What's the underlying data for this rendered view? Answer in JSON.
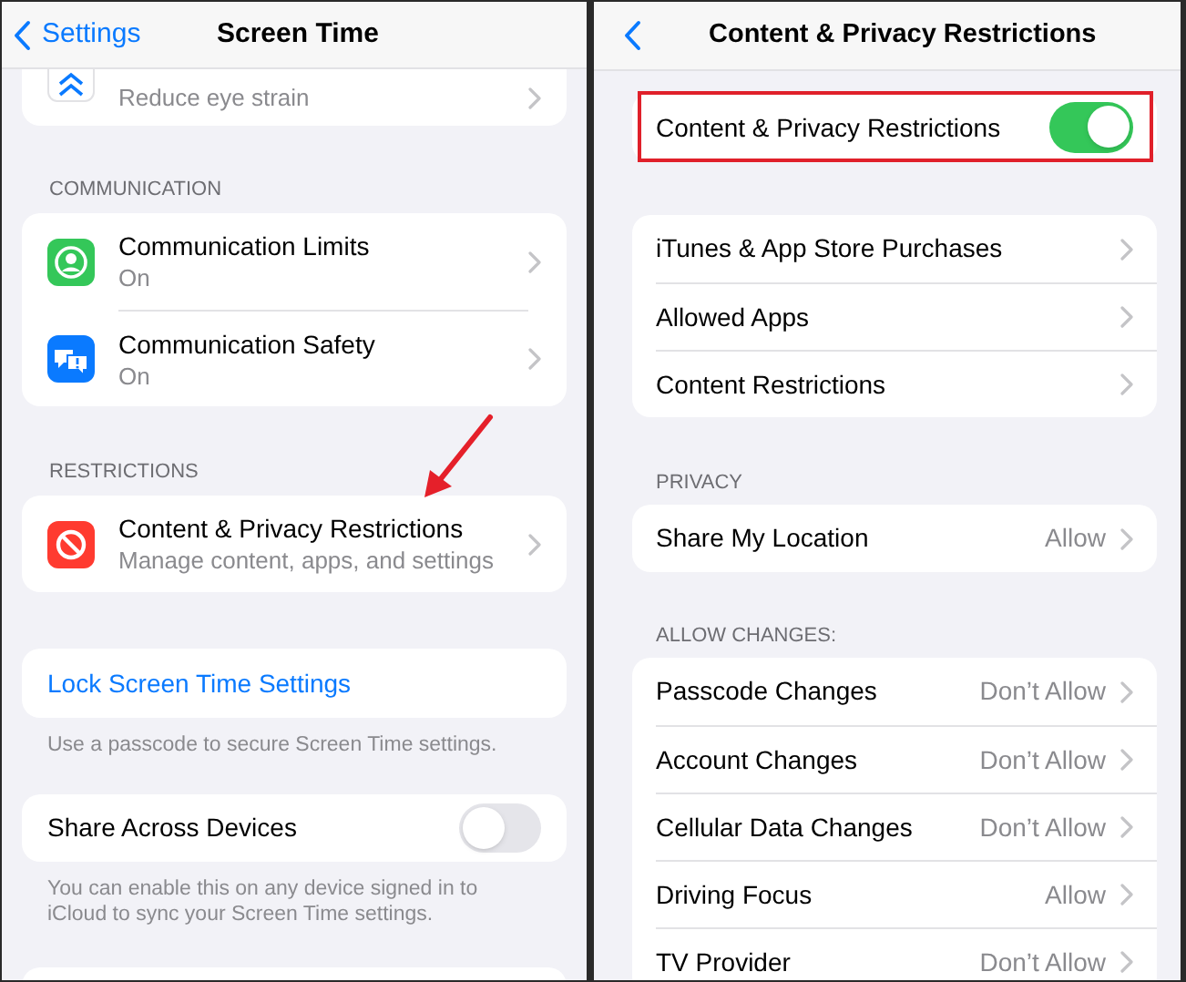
{
  "left": {
    "nav": {
      "back": "Settings",
      "title": "Screen Time"
    },
    "partial_item": {
      "subtitle": "Reduce eye strain"
    },
    "sections": [
      {
        "header": "COMMUNICATION",
        "rows": [
          {
            "title": "Communication Limits",
            "subtitle": "On",
            "color": "#34c759"
          },
          {
            "title": "Communication Safety",
            "subtitle": "On",
            "color": "#0a7aff"
          }
        ]
      },
      {
        "header": "RESTRICTIONS",
        "rows": [
          {
            "title": "Content & Privacy Restrictions",
            "subtitle": "Manage content, apps, and settings",
            "color": "#ff3b30"
          }
        ]
      }
    ],
    "lock": {
      "label": "Lock Screen Time Settings",
      "footnote": "Use a passcode to secure Screen Time settings."
    },
    "share": {
      "label": "Share Across Devices",
      "on": false,
      "footnote": "You can enable this on any device signed in to iCloud to sync your Screen Time settings."
    }
  },
  "right": {
    "nav": {
      "title": "Content & Privacy Restrictions"
    },
    "master": {
      "label": "Content & Privacy Restrictions",
      "on": true
    },
    "sections": [
      {
        "rows": [
          {
            "title": "iTunes & App Store Purchases"
          },
          {
            "title": "Allowed Apps"
          },
          {
            "title": "Content Restrictions"
          }
        ]
      },
      {
        "header": "PRIVACY",
        "rows": [
          {
            "title": "Share My Location",
            "value": "Allow"
          }
        ]
      },
      {
        "header": "ALLOW CHANGES:",
        "rows": [
          {
            "title": "Passcode Changes",
            "value": "Don’t Allow"
          },
          {
            "title": "Account Changes",
            "value": "Don’t Allow"
          },
          {
            "title": "Cellular Data Changes",
            "value": "Don’t Allow"
          },
          {
            "title": "Driving Focus",
            "value": "Allow"
          },
          {
            "title": "TV Provider",
            "value": "Don’t Allow"
          }
        ]
      }
    ]
  }
}
